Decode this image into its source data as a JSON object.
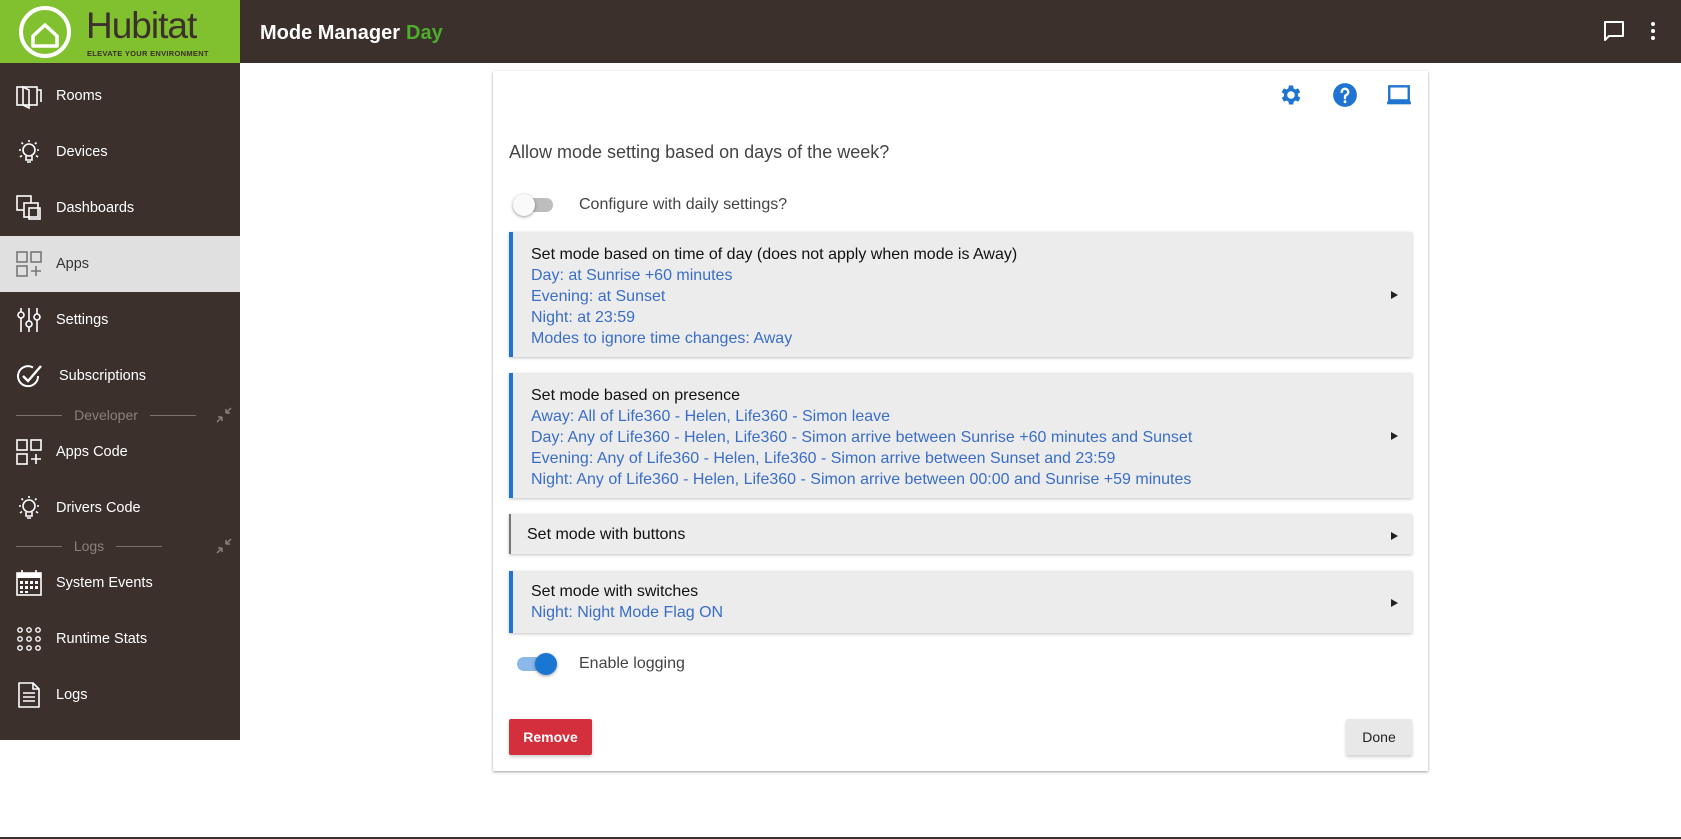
{
  "brand": {
    "name": "Hubitat",
    "tagline": "ELEVATE YOUR ENVIRONMENT",
    "color": "#81c02f"
  },
  "header": {
    "title": "Mode Manager",
    "mode": "Day",
    "mode_color": "#4caf2a"
  },
  "sidebar": {
    "items": [
      {
        "label": "Rooms",
        "icon": "rooms-icon"
      },
      {
        "label": "Devices",
        "icon": "bulb-icon"
      },
      {
        "label": "Dashboards",
        "icon": "dashboards-icon"
      },
      {
        "label": "Apps",
        "icon": "apps-icon",
        "active": true
      },
      {
        "label": "Settings",
        "icon": "sliders-icon"
      },
      {
        "label": "Subscriptions",
        "icon": "check-circle-icon"
      }
    ],
    "developer_label": "Developer",
    "developer_items": [
      {
        "label": "Apps Code",
        "icon": "apps-code-icon"
      },
      {
        "label": "Drivers Code",
        "icon": "bulb-icon"
      }
    ],
    "logs_label": "Logs",
    "logs_items": [
      {
        "label": "System Events",
        "icon": "calendar-icon"
      },
      {
        "label": "Runtime Stats",
        "icon": "grid-dots-icon"
      },
      {
        "label": "Logs",
        "icon": "document-icon"
      }
    ]
  },
  "main": {
    "question": "Allow mode setting based on days of the week?",
    "daily_toggle": {
      "label": "Configure with daily settings?",
      "checked": false
    },
    "sections": [
      {
        "title": "Set mode based on time of day (does not apply when mode is Away)",
        "lines": [
          "Day: at Sunrise +60 minutes",
          "Evening: at Sunset",
          "Night: at 23:59",
          "Modes to ignore time changes: Away"
        ]
      },
      {
        "title": "Set mode based on presence",
        "lines": [
          "Away: All of Life360 - Helen, Life360 - Simon leave",
          "Day: Any of Life360 - Helen, Life360 - Simon arrive between Sunrise +60 minutes and Sunset",
          "Evening: Any of Life360 - Helen, Life360 - Simon arrive between Sunset and 23:59",
          "Night: Any of Life360 - Helen, Life360 - Simon arrive between 00:00 and Sunrise +59 minutes"
        ]
      },
      {
        "title": "Set mode with buttons",
        "lines": []
      },
      {
        "title": "Set mode with switches",
        "lines": [
          "Night: Night Mode Flag ON"
        ]
      }
    ],
    "logging_toggle": {
      "label": "Enable logging",
      "checked": true
    },
    "remove_label": "Remove",
    "done_label": "Done"
  },
  "colors": {
    "topbar": "#3b302c",
    "accent_blue": "#1e74d0",
    "link_blue": "#3a6ec6",
    "remove_red": "#d32f3c"
  }
}
